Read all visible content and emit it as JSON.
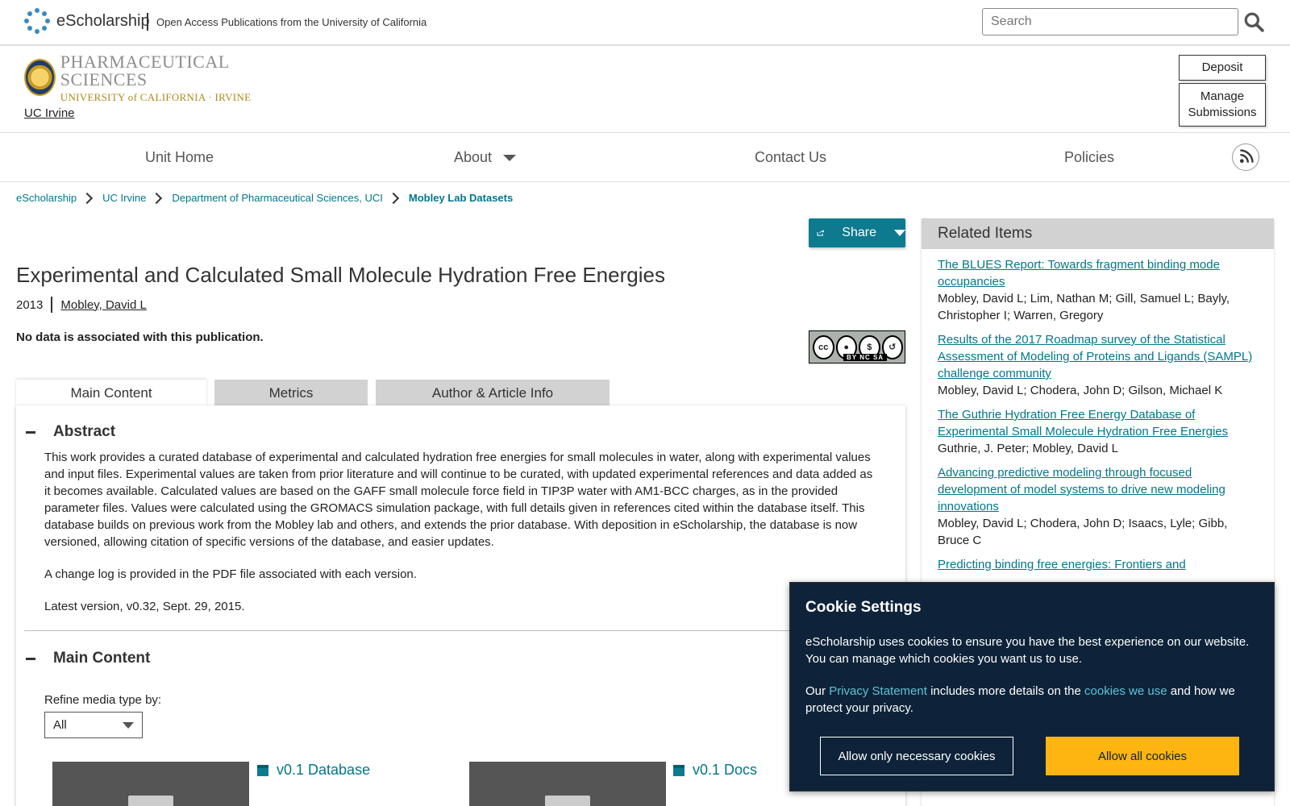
{
  "header": {
    "brand": "eScholarship",
    "tagline": "Open Access Publications from the University of California",
    "search_placeholder": "Search"
  },
  "unit": {
    "banner_line1": "PHARMACEUTICAL SCIENCES",
    "banner_line2": "UNIVERSITY of CALIFORNIA · IRVINE",
    "campus_link": "UC Irvine",
    "deposit_label": "Deposit",
    "manage_label": "Manage Submissions"
  },
  "nav": {
    "items": [
      "Unit Home",
      "About",
      "Contact Us",
      "Policies"
    ]
  },
  "breadcrumb": [
    "eScholarship",
    "UC Irvine",
    "Department of Pharmaceutical Sciences, UCI",
    "Mobley Lab Datasets"
  ],
  "share_label": "Share",
  "article": {
    "title": "Experimental and Calculated Small Molecule Hydration Free Energies",
    "year": "2013",
    "author": "Mobley, David L",
    "no_data": "No data is associated with this publication.",
    "license": "BY NC SA"
  },
  "tabs": [
    "Main Content",
    "Metrics",
    "Author & Article Info"
  ],
  "abstract": {
    "heading": "Abstract",
    "paragraphs": [
      "This work provides a curated database of experimental and calculated hydration free energies for small molecules in water, along with experimental values and input files. Experimental values are taken from prior literature and will continue to be curated, with updated experimental references and data added as it becomes available. Calculated values are based on the GAFF small molecule force field in TIP3P water with AM1-BCC charges, as in the provided parameter files. Values were calculated using the GROMACS simulation package, with full details given in references cited within the database itself. This database builds on previous work from the Mobley lab and others, and extends the prior database. With deposition in eScholarship, the database is now versioned, allowing citation of specific versions of the database, and easier updates.",
      "A change log is provided in the PDF file associated with each version.",
      "Latest version, v0.32, Sept. 29, 2015."
    ]
  },
  "main_content": {
    "heading": "Main Content",
    "refine_label": "Refine media type by:",
    "refine_value": "All",
    "media": [
      "v0.1 Database",
      "v0.1 Docs"
    ]
  },
  "related": {
    "heading": "Related Items",
    "items": [
      {
        "title": "The BLUES Report: Towards fragment binding mode occupancies",
        "authors": "Mobley, David L;  Lim, Nathan M;  Gill, Samuel L;  Bayly, Christopher I;  Warren, Gregory"
      },
      {
        "title": "Results of the 2017 Roadmap survey of the Statistical Assessment of Modeling of Proteins and Ligands (SAMPL) challenge community",
        "authors": "Mobley, David L;  Chodera, John D;  Gilson, Michael K"
      },
      {
        "title": "The Guthrie Hydration Free Energy Database of Experimental Small Molecule Hydration Free Energies",
        "authors": "Guthrie, J. Peter;  Mobley, David L"
      },
      {
        "title": "Advancing predictive modeling through focused development of model systems to drive new modeling innovations",
        "authors": "Mobley, David L;  Chodera, John D;  Isaacs, Lyle;  Gibb, Bruce C"
      },
      {
        "title": "Predicting binding free energies: Frontiers and",
        "authors": ""
      }
    ]
  },
  "cookie": {
    "title": "Cookie Settings",
    "text1": "eScholarship uses cookies to ensure you have the best experience on our website. You can manage which cookies you want us to use.",
    "text2_a": "Our ",
    "privacy_link": "Privacy Statement",
    "text2_b": " includes more details on the ",
    "cookies_link": "cookies we use",
    "text2_c": " and how we protect your privacy.",
    "btn_necessary": "Allow only necessary cookies",
    "btn_all": "Allow all cookies"
  }
}
